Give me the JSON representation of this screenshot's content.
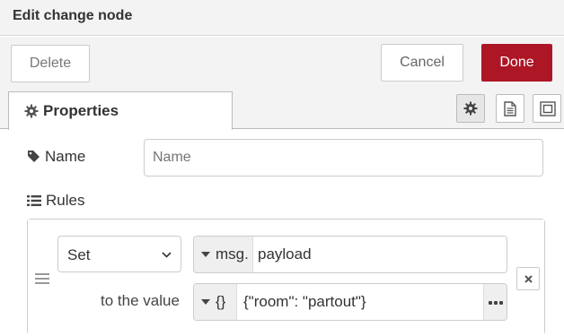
{
  "dialog": {
    "title": "Edit change node"
  },
  "toolbar": {
    "delete_label": "Delete",
    "cancel_label": "Cancel",
    "done_label": "Done"
  },
  "tabs": {
    "properties_label": "Properties"
  },
  "form": {
    "name_label": "Name",
    "name_placeholder": "Name",
    "name_value": "",
    "rules_label": "Rules"
  },
  "rule": {
    "action_value": "Set",
    "property_type": "msg.",
    "property_value": "payload",
    "to_value_label": "to the value",
    "value_type": "{}",
    "value_value": "{\"room\": \"partout\"}"
  },
  "colors": {
    "primary": "#ad1625",
    "toolbar_bg": "#f3f3f3"
  },
  "icons": [
    "gear-icon",
    "document-icon",
    "frame-icon",
    "tag-icon",
    "list-icon",
    "drag-handle-icon",
    "caret-down-icon",
    "ellipsis-icon",
    "close-icon"
  ]
}
